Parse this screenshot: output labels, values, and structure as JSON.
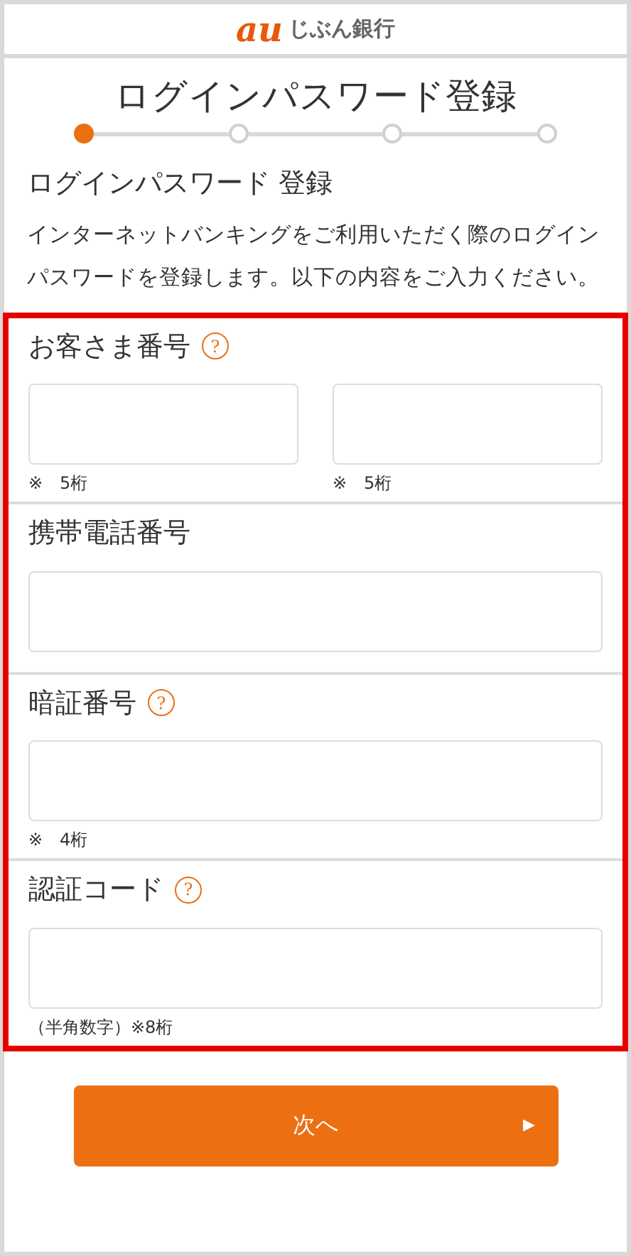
{
  "header": {
    "logo_mark": "au",
    "logo_text": "じぶん銀行"
  },
  "title": "ログインパスワード登録",
  "steps": [
    {
      "selected": true
    },
    {
      "selected": false
    },
    {
      "selected": false
    },
    {
      "selected": false
    }
  ],
  "subtitle": "ログインパスワード 登録",
  "intro": "インターネットバンキングをご利用いただく際のログインパスワードを登録します。以下の内容をご入力ください。",
  "highlighted": true,
  "sections": [
    {
      "label": "お客さま番号",
      "help": "?",
      "fields": [
        {
          "kind": "text",
          "note": "※　5桁"
        },
        {
          "kind": "text",
          "note": "※　5桁"
        }
      ]
    },
    {
      "label": "携帯電話番号",
      "fields": [
        {
          "kind": "text"
        }
      ]
    },
    {
      "label": "暗証番号",
      "help": "?",
      "fields": [
        {
          "kind": "text",
          "note": "※　4桁"
        }
      ]
    },
    {
      "label": "認証コード",
      "help": "?",
      "fields": [
        {
          "kind": "text",
          "note": "（半角数字）※8桁"
        }
      ]
    }
  ],
  "next_button": {
    "label": "次へ",
    "arrow": "▶"
  }
}
